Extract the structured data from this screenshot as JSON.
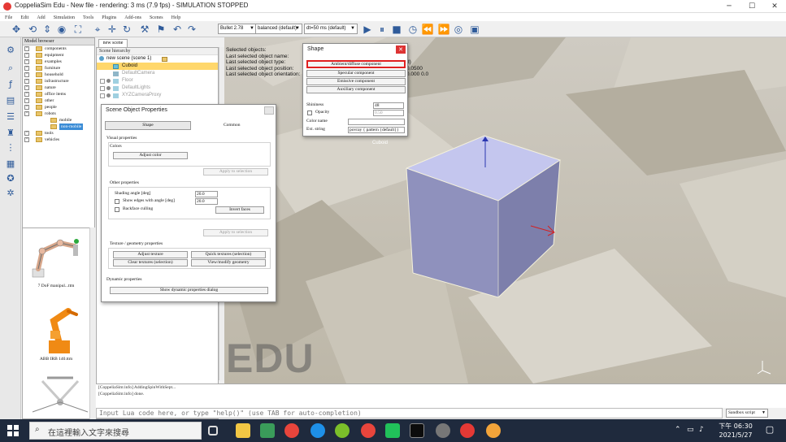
{
  "window": {
    "title": "CoppeliaSim Edu - New file - rendering: 3 ms (7.9 fps) - SIMULATION STOPPED",
    "minimize": "─",
    "maximize": "☐",
    "close": "✕"
  },
  "menu": [
    "File",
    "Edit",
    "Add",
    "Simulation",
    "Tools",
    "Plugins",
    "Add-ons",
    "Scenes",
    "Help"
  ],
  "toolbar": {
    "engine": "Bullet 2.78",
    "accuracy": "balanced (default)",
    "timestep": "dt=50 ms (default)"
  },
  "model_browser": {
    "header": "Model browser",
    "items": [
      {
        "label": "components",
        "indent": 0
      },
      {
        "label": "equipment",
        "indent": 0
      },
      {
        "label": "examples",
        "indent": 0
      },
      {
        "label": "furniture",
        "indent": 0
      },
      {
        "label": "household",
        "indent": 0
      },
      {
        "label": "infrastructure",
        "indent": 0
      },
      {
        "label": "nature",
        "indent": 0
      },
      {
        "label": "office items",
        "indent": 0
      },
      {
        "label": "other",
        "indent": 0
      },
      {
        "label": "people",
        "indent": 0
      },
      {
        "label": "robots",
        "indent": 0
      },
      {
        "label": "mobile",
        "indent": 1
      },
      {
        "label": "non-mobile",
        "indent": 1,
        "selected": true
      },
      {
        "label": "tools",
        "indent": 0
      },
      {
        "label": "vehicles",
        "indent": 0
      }
    ],
    "thumbnails": [
      "7 DoF manipul...ttm",
      "ABB IRB 140.ttm"
    ]
  },
  "scene": {
    "tab": "new scene",
    "hierarchy_header": "Scene hierarchy",
    "root": "new scene (scene 1)",
    "items": [
      {
        "label": "Cuboid",
        "selected": true
      },
      {
        "label": "DefaultCamera",
        "dim": true
      },
      {
        "label": "Floor",
        "dim": true
      },
      {
        "label": "DefaultLights",
        "dim": true
      },
      {
        "label": "XYZCameraProxy",
        "dim": true
      }
    ]
  },
  "viewport": {
    "info_lines": [
      "Selected objects:",
      "Last selected object name:",
      "Last selected object type:",
      "Last selected object position:",
      "Last selected object orientation:"
    ],
    "info_values": [
      "d)",
      "0.0500",
      "0.000 0.0"
    ],
    "watermark": "EDU",
    "object_label": "Cuboid"
  },
  "scene_object_properties": {
    "title": "Scene Object Properties",
    "tab_shape": "Shape",
    "tab_common": "Common",
    "visual_heading": "Visual properties",
    "colors_label": "Colors",
    "adjust_color": "Adjust color",
    "apply_selection": "Apply to selection",
    "other_heading": "Other properties",
    "shading_label": "Shading angle [deg]",
    "shading_value": "20.0",
    "show_edges_label": "Show edges with angle [deg]",
    "show_edges_value": "20.0",
    "backface_label": "Backface culling",
    "invert_faces": "Invert faces",
    "apply_selection_2": "Apply to selection",
    "texture_heading": "Texture / geometry properties",
    "adjust_texture": "Adjust texture",
    "quick_textures": "Quick textures (selection)",
    "clear_textures": "Clear textures (selection)",
    "view_geometry": "View/modify geometry",
    "dynamic_heading": "Dynamic properties",
    "dynamic_dialog": "Show dynamic properties dialog"
  },
  "shape_dialog": {
    "title": "Shape",
    "close": "✕",
    "ambient": "Ambient/diffuse component",
    "specular": "Specular component",
    "emissive": "Emissive component",
    "auxiliary": "Auxiliary component",
    "shininess_label": "Shininess",
    "shininess_value": "48",
    "opacity_label": "Opacity",
    "opacity_value": "0.50",
    "color_name_label": "Color name",
    "color_name_value": "",
    "ext_label": "Ext. string",
    "ext_value": "povray { pattern {default}}"
  },
  "console": {
    "lines": [
      "[CoppeliaSim:info] AddingSpinWithSept...",
      "[CoppeliaSim:info] done."
    ],
    "lua_placeholder": "Input Lua code here, or type \"help()\" (use TAB for auto-completion)",
    "sandbox": "Sandbox script"
  },
  "taskbar": {
    "search_placeholder": "在這裡輸入文字來搜尋",
    "time": "下午 06:30",
    "date": "2021/5/27"
  },
  "colors": {
    "accent_red": "#e02020",
    "selection_yellow": "#ffd76b",
    "tree_selection": "#3b8cd6",
    "cube_top": "#c4c6ee",
    "cube_front": "#8f91bd",
    "cube_right": "#7d7fab"
  }
}
